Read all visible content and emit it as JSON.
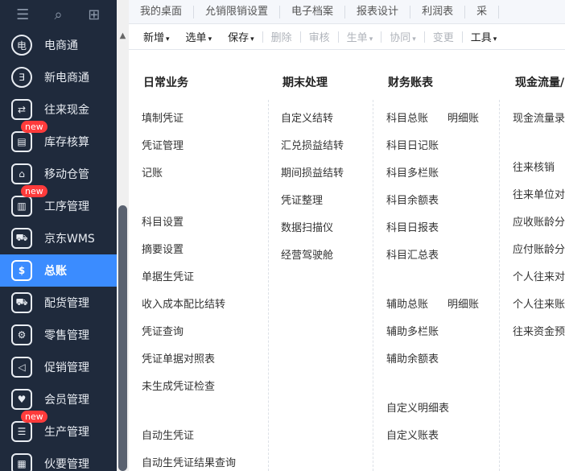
{
  "sidebar": {
    "top_icons": [
      "menu-icon",
      "search-icon",
      "add-doc-icon"
    ],
    "items": [
      {
        "label": "电商通",
        "icon": "电"
      },
      {
        "label": "新电商通",
        "icon": "∃"
      },
      {
        "label": "往来现金",
        "icon": "⇄"
      },
      {
        "label": "库存核算",
        "icon": "▤",
        "badge": "new"
      },
      {
        "label": "移动仓管",
        "icon": "⌂"
      },
      {
        "label": "工序管理",
        "icon": "▥",
        "badge": "new"
      },
      {
        "label": "京东WMS",
        "icon": "⛟"
      },
      {
        "label": "总账",
        "icon": "$",
        "active": true
      },
      {
        "label": "配货管理",
        "icon": "⛟"
      },
      {
        "label": "零售管理",
        "icon": "⚙"
      },
      {
        "label": "促销管理",
        "icon": "◁"
      },
      {
        "label": "会员管理",
        "icon": "♥"
      },
      {
        "label": "生产管理",
        "icon": "☰",
        "badge": "new"
      },
      {
        "label": "伙要管理",
        "icon": "▦"
      }
    ]
  },
  "tabs": [
    "我的桌面",
    "允销限销设置",
    "电子档案",
    "报表设计",
    "利润表",
    "采"
  ],
  "toolbar": {
    "buttons": [
      {
        "label": "新增",
        "caret": "▾",
        "disabled": false
      },
      {
        "label": "选单",
        "caret": "▾",
        "disabled": false
      },
      {
        "label": "保存",
        "caret": "▾",
        "disabled": false
      },
      {
        "label": "删除",
        "caret": "",
        "disabled": true
      },
      {
        "label": "审核",
        "caret": "",
        "disabled": true
      },
      {
        "label": "生单",
        "caret": "▾",
        "disabled": true
      },
      {
        "label": "协同",
        "caret": "▾",
        "disabled": true
      },
      {
        "label": "变更",
        "caret": "",
        "disabled": true
      },
      {
        "label": "工具",
        "caret": "▾",
        "disabled": false
      }
    ]
  },
  "menu": {
    "columns": [
      {
        "title": "日常业务",
        "items": [
          "填制凭证",
          "凭证管理",
          "记账",
          "科目设置",
          "摘要设置",
          "单据生凭证",
          "收入成本配比结转",
          "凭证查询",
          "凭证单据对照表",
          "未生成凭证检查",
          "自动生凭证",
          "自动生凭证结果查询"
        ]
      },
      {
        "title": "期末处理",
        "items": [
          "自定义结转",
          "汇兑损益结转",
          "期间损益结转",
          "凭证整理",
          "数据扫描仪",
          "经营驾驶舱"
        ]
      },
      {
        "title": "财务账表",
        "items": [
          "科目总账",
          "明细账",
          "科目日记账",
          "科目多栏账",
          "科目余额表",
          "科目日报表",
          "科目汇总表",
          "辅助总账",
          "明细账",
          "辅助多栏账",
          "辅助余额表",
          "自定义明细表",
          "自定义账表"
        ]
      },
      {
        "title": "现金流量/",
        "items": [
          "现金流量录",
          "往来核销",
          "往来单位对",
          "应收账龄分",
          "应付账龄分",
          "个人往来对",
          "个人往来账",
          "往来资金预"
        ]
      }
    ]
  }
}
